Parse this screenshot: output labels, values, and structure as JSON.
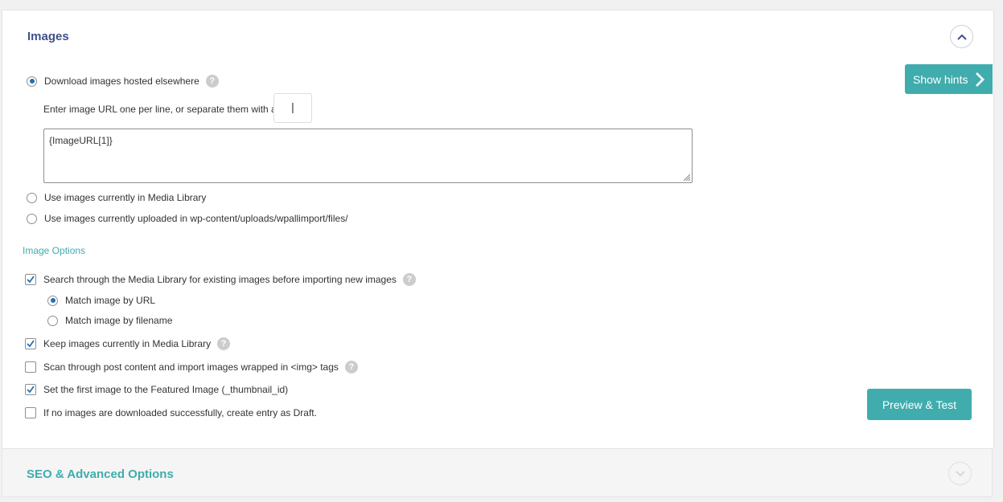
{
  "images_section": {
    "title": "Images",
    "source_options": {
      "download": "Download images hosted elsewhere",
      "url_hint": "Enter image URL one per line, or separate them with a",
      "separator_value": "|",
      "url_textarea_value": "{ImageURL[1]}",
      "media_library": "Use images currently in Media Library",
      "uploads": "Use images currently uploaded in wp-content/uploads/wpallimport/files/"
    },
    "options_heading": "Image Options",
    "options": {
      "search_media": "Search through the Media Library for existing images before importing new images",
      "match_url": "Match image by URL",
      "match_filename": "Match image by filename",
      "keep_images": "Keep images currently in Media Library",
      "scan_content": "Scan through post content and import images wrapped in <img> tags",
      "featured": "Set the first image to the Featured Image (_thumbnail_id)",
      "draft": "If no images are downloaded successfully, create entry as Draft."
    },
    "help_glyph": "?"
  },
  "show_hints_label": "Show hints",
  "preview_button_label": "Preview & Test",
  "seo_section_title": "SEO & Advanced Options",
  "state": {
    "source_selected": "download",
    "match_selected": "url",
    "search_media_checked": true,
    "keep_images_checked": true,
    "scan_content_checked": false,
    "featured_checked": true,
    "draft_checked": false
  },
  "colors": {
    "accent": "#40acad",
    "title_blue": "#40518a",
    "check_blue": "#2271b1"
  }
}
